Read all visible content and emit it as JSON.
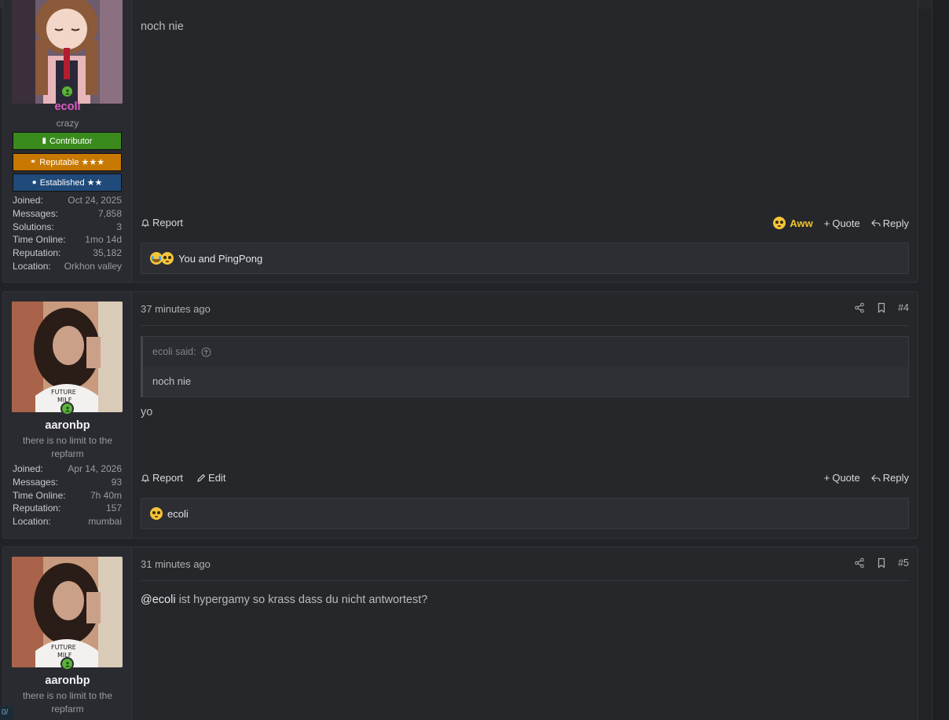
{
  "posts": [
    {
      "username": "ecoli",
      "user_title": "crazy",
      "username_color": "#e25bc7",
      "banners": [
        {
          "label": "Contributor",
          "icon": "book-icon",
          "color": "#3a8a1e"
        },
        {
          "label": "Reputable ★★★",
          "icon": "handshake-icon",
          "color": "#c77800"
        },
        {
          "label": "Established ★★",
          "icon": "user-icon",
          "color": "#1f4a7a"
        }
      ],
      "stats": [
        {
          "k": "Joined:",
          "v": "Oct 24, 2025"
        },
        {
          "k": "Messages:",
          "v": "7,858"
        },
        {
          "k": "Solutions:",
          "v": "3"
        },
        {
          "k": "Time Online:",
          "v": "1mo 14d"
        },
        {
          "k": "Reputation:",
          "v": "35,182"
        },
        {
          "k": "Location:",
          "v": "Orkhon valley"
        }
      ],
      "body": "noch nie",
      "actions_left": [
        "Report"
      ],
      "aww_label": "Aww",
      "actions_right": [
        "Quote",
        "Reply"
      ],
      "reactions": "You and PingPong"
    },
    {
      "username": "aaronbp",
      "user_title": "there is no limit to the repfarm",
      "time": "37 minutes ago",
      "number": "#4",
      "stats": [
        {
          "k": "Joined:",
          "v": "Apr 14, 2026"
        },
        {
          "k": "Messages:",
          "v": "93"
        },
        {
          "k": "Time Online:",
          "v": "7h 40m"
        },
        {
          "k": "Reputation:",
          "v": "157"
        },
        {
          "k": "Location:",
          "v": "mumbai"
        }
      ],
      "quote_author": "ecoli said:",
      "quote_text": "noch nie",
      "body": "yo",
      "actions_left": [
        "Report",
        "Edit"
      ],
      "actions_right": [
        "Quote",
        "Reply"
      ],
      "reactions": "ecoli"
    },
    {
      "username": "aaronbp",
      "user_title": "there is no limit to the repfarm",
      "time": "31 minutes ago",
      "number": "#5",
      "mention": "@ecoli",
      "body": " ist hypergamy so krass dass du nicht antwortest?"
    }
  ],
  "corner_tag": "0/"
}
